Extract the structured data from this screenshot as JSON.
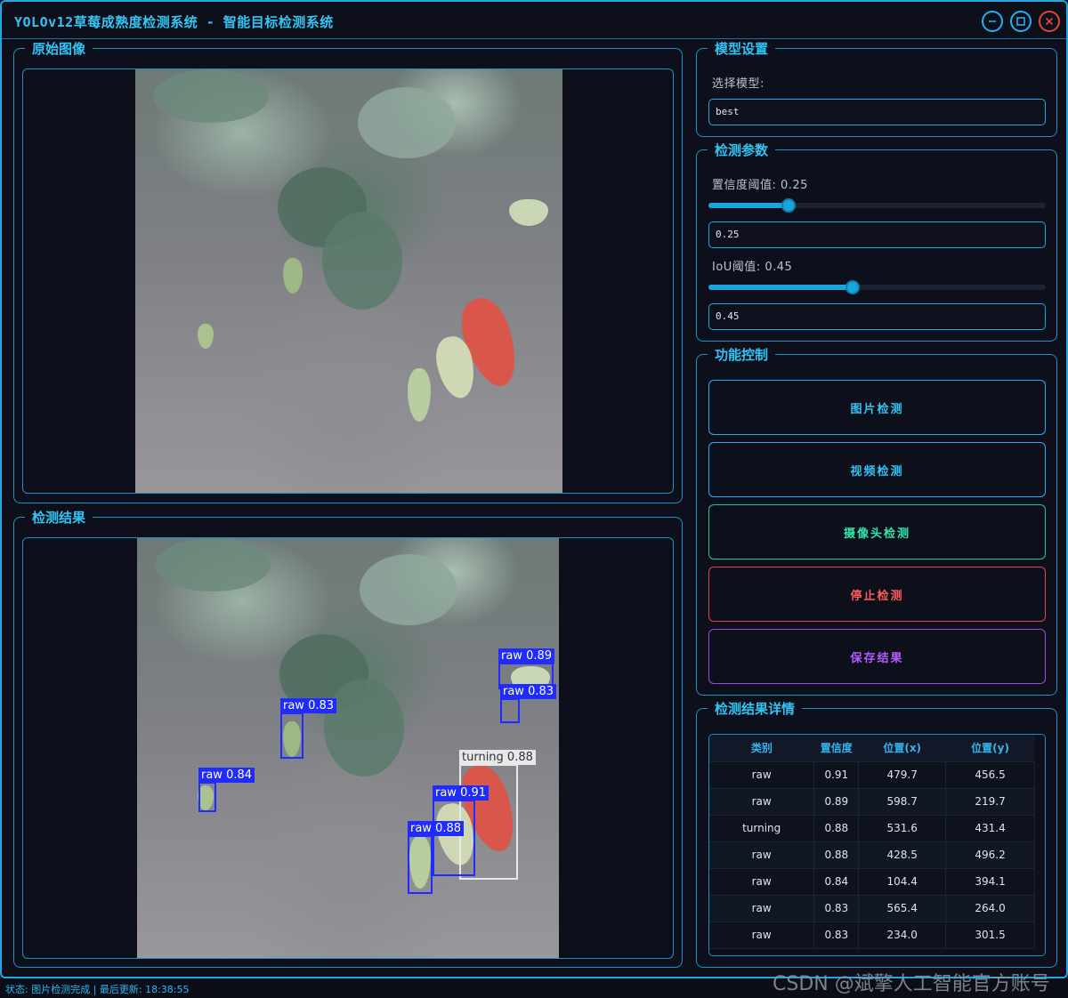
{
  "window": {
    "title": "YOLOv12草莓成熟度检测系统 - 智能目标检测系统"
  },
  "original": {
    "title": "原始图像"
  },
  "result": {
    "title": "检测结果",
    "detections": [
      {
        "label": "raw 0.89"
      },
      {
        "label": "raw 0.83"
      },
      {
        "label": "raw 0.83"
      },
      {
        "label": "turning 0.88"
      },
      {
        "label": "raw 0.84"
      },
      {
        "label": "raw 0.91"
      },
      {
        "label": "raw 0.88"
      }
    ]
  },
  "model": {
    "title": "模型设置",
    "select_label": "选择模型:",
    "select_value": "best"
  },
  "params": {
    "title": "检测参数",
    "conf_label": "置信度阈值: 0.25",
    "conf_value": "0.25",
    "conf_fraction": 0.25,
    "iou_label": "IoU阈值: 0.45",
    "iou_value": "0.45",
    "iou_fraction": 0.45
  },
  "control": {
    "title": "功能控制",
    "image_btn": "图片检测",
    "video_btn": "视频检测",
    "camera_btn": "摄像头检测",
    "stop_btn": "停止检测",
    "save_btn": "保存结果"
  },
  "details": {
    "title": "检测结果详情",
    "headers": [
      "类别",
      "置信度",
      "位置(x)",
      "位置(y)"
    ],
    "rows": [
      [
        "raw",
        "0.91",
        "479.7",
        "456.5"
      ],
      [
        "raw",
        "0.89",
        "598.7",
        "219.7"
      ],
      [
        "turning",
        "0.88",
        "531.6",
        "431.4"
      ],
      [
        "raw",
        "0.88",
        "428.5",
        "496.2"
      ],
      [
        "raw",
        "0.84",
        "104.4",
        "394.1"
      ],
      [
        "raw",
        "0.83",
        "565.4",
        "264.0"
      ],
      [
        "raw",
        "0.83",
        "234.0",
        "301.5"
      ]
    ]
  },
  "status": "状态: 图片检测完成 | 最后更新: 18:38:55",
  "watermark": "CSDN @斌擎人工智能官方账号",
  "colors": {
    "accent": "#32c3f5",
    "image_btn": "#32c3f5",
    "video_btn": "#32c3f5",
    "camera_btn": "#2ee6a8",
    "stop_btn": "#ff5a5a",
    "save_btn": "#b35cff"
  }
}
